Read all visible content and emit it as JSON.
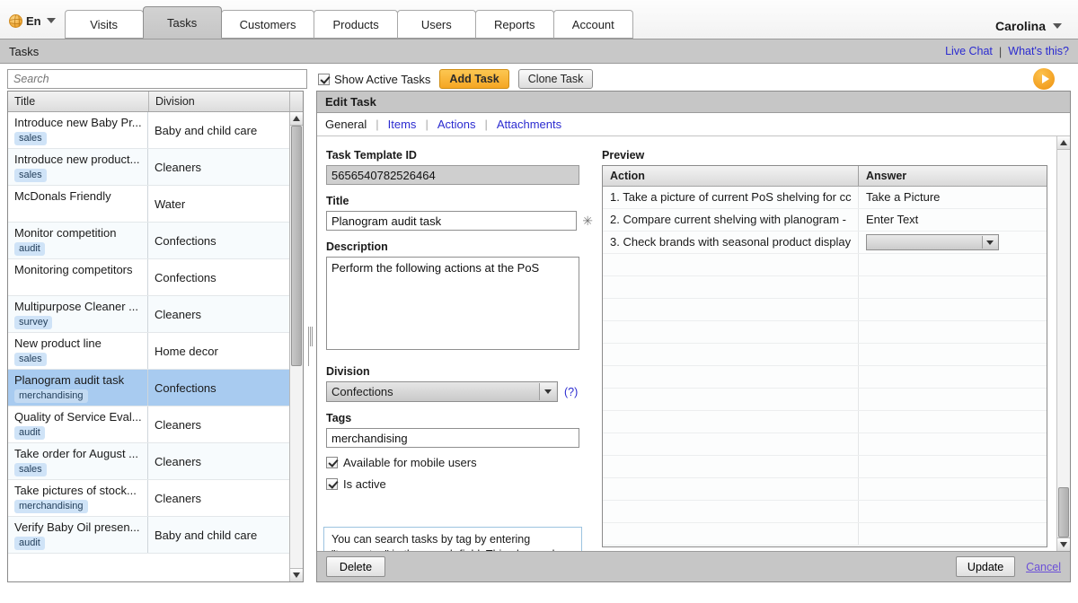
{
  "topbar": {
    "lang": {
      "icon": "globe-icon",
      "label": "En"
    },
    "tabs": [
      {
        "label": "Visits",
        "active": false
      },
      {
        "label": "Tasks",
        "active": true
      },
      {
        "label": "Customers",
        "active": false
      },
      {
        "label": "Products",
        "active": false
      },
      {
        "label": "Users",
        "active": false
      },
      {
        "label": "Reports",
        "active": false
      },
      {
        "label": "Account",
        "active": false
      }
    ],
    "user": "Carolina"
  },
  "breadcrumb": {
    "current": "Tasks",
    "links": [
      "Live Chat",
      "What's this?"
    ],
    "separator": "|"
  },
  "toolbar": {
    "search_placeholder": "Search",
    "search_value": "",
    "show_active_label": "Show Active Tasks",
    "show_active_checked": true,
    "add_task_label": "Add Task",
    "clone_task_label": "Clone Task",
    "play_icon": "play-circle-icon"
  },
  "task_grid": {
    "columns": [
      "Title",
      "Division"
    ],
    "rows": [
      {
        "title": "Introduce new Baby Pr...",
        "tag": "sales",
        "division": "Baby and child care",
        "selected": false
      },
      {
        "title": "Introduce new product...",
        "tag": "sales",
        "division": "Cleaners",
        "selected": false
      },
      {
        "title": "McDonals Friendly",
        "tag": "",
        "division": "Water",
        "selected": false
      },
      {
        "title": "Monitor competition",
        "tag": "audit",
        "division": "Confections",
        "selected": false
      },
      {
        "title": "Monitoring competitors",
        "tag": "",
        "division": "Confections",
        "selected": false
      },
      {
        "title": "Multipurpose Cleaner ...",
        "tag": "survey",
        "division": "Cleaners",
        "selected": false
      },
      {
        "title": "New product line",
        "tag": "sales",
        "division": "Home decor",
        "selected": false
      },
      {
        "title": "Planogram audit task",
        "tag": "merchandising",
        "division": "Confections",
        "selected": true
      },
      {
        "title": "Quality of Service Eval...",
        "tag": "audit",
        "division": "Cleaners",
        "selected": false
      },
      {
        "title": "Take order for August ...",
        "tag": "sales",
        "division": "Cleaners",
        "selected": false
      },
      {
        "title": "Take pictures of stock...",
        "tag": "merchandising",
        "division": "Cleaners",
        "selected": false
      },
      {
        "title": "Verify Baby Oil presen...",
        "tag": "audit",
        "division": "Baby and child care",
        "selected": false
      }
    ]
  },
  "edit_panel": {
    "title": "Edit Task",
    "subtabs": [
      {
        "label": "General",
        "current": true
      },
      {
        "label": "Items",
        "current": false
      },
      {
        "label": "Actions",
        "current": false
      },
      {
        "label": "Attachments",
        "current": false
      }
    ],
    "fields": {
      "template_id_label": "Task Template ID",
      "template_id_value": "5656540782526464",
      "title_label": "Title",
      "title_value": "Planogram audit task",
      "required_marker": "✳",
      "description_label": "Description",
      "description_value": "Perform the following actions at the PoS",
      "division_label": "Division",
      "division_value": "Confections",
      "division_help": "(?)",
      "tags_label": "Tags",
      "tags_value": "merchandising",
      "mobile_label": "Available for mobile users",
      "mobile_checked": true,
      "active_label": "Is active",
      "active_checked": true
    },
    "tip": "You can search tasks by tag by entering \"tag:mytag\" in the search field. This also works when adding tasks on the Visit",
    "preview": {
      "title": "Preview",
      "columns": [
        "Action",
        "Answer"
      ],
      "rows": [
        {
          "action": "1. Take a picture of current PoS shelving for cc",
          "answer": "Take a Picture",
          "answer_type": "text"
        },
        {
          "action": "2. Compare current shelving with planogram - ",
          "answer": "Enter Text",
          "answer_type": "text"
        },
        {
          "action": "3. Check brands with seasonal product display",
          "answer": "",
          "answer_type": "select"
        }
      ],
      "empty_row_count": 13
    },
    "footer": {
      "delete_label": "Delete",
      "update_label": "Update",
      "cancel_label": "Cancel"
    }
  }
}
